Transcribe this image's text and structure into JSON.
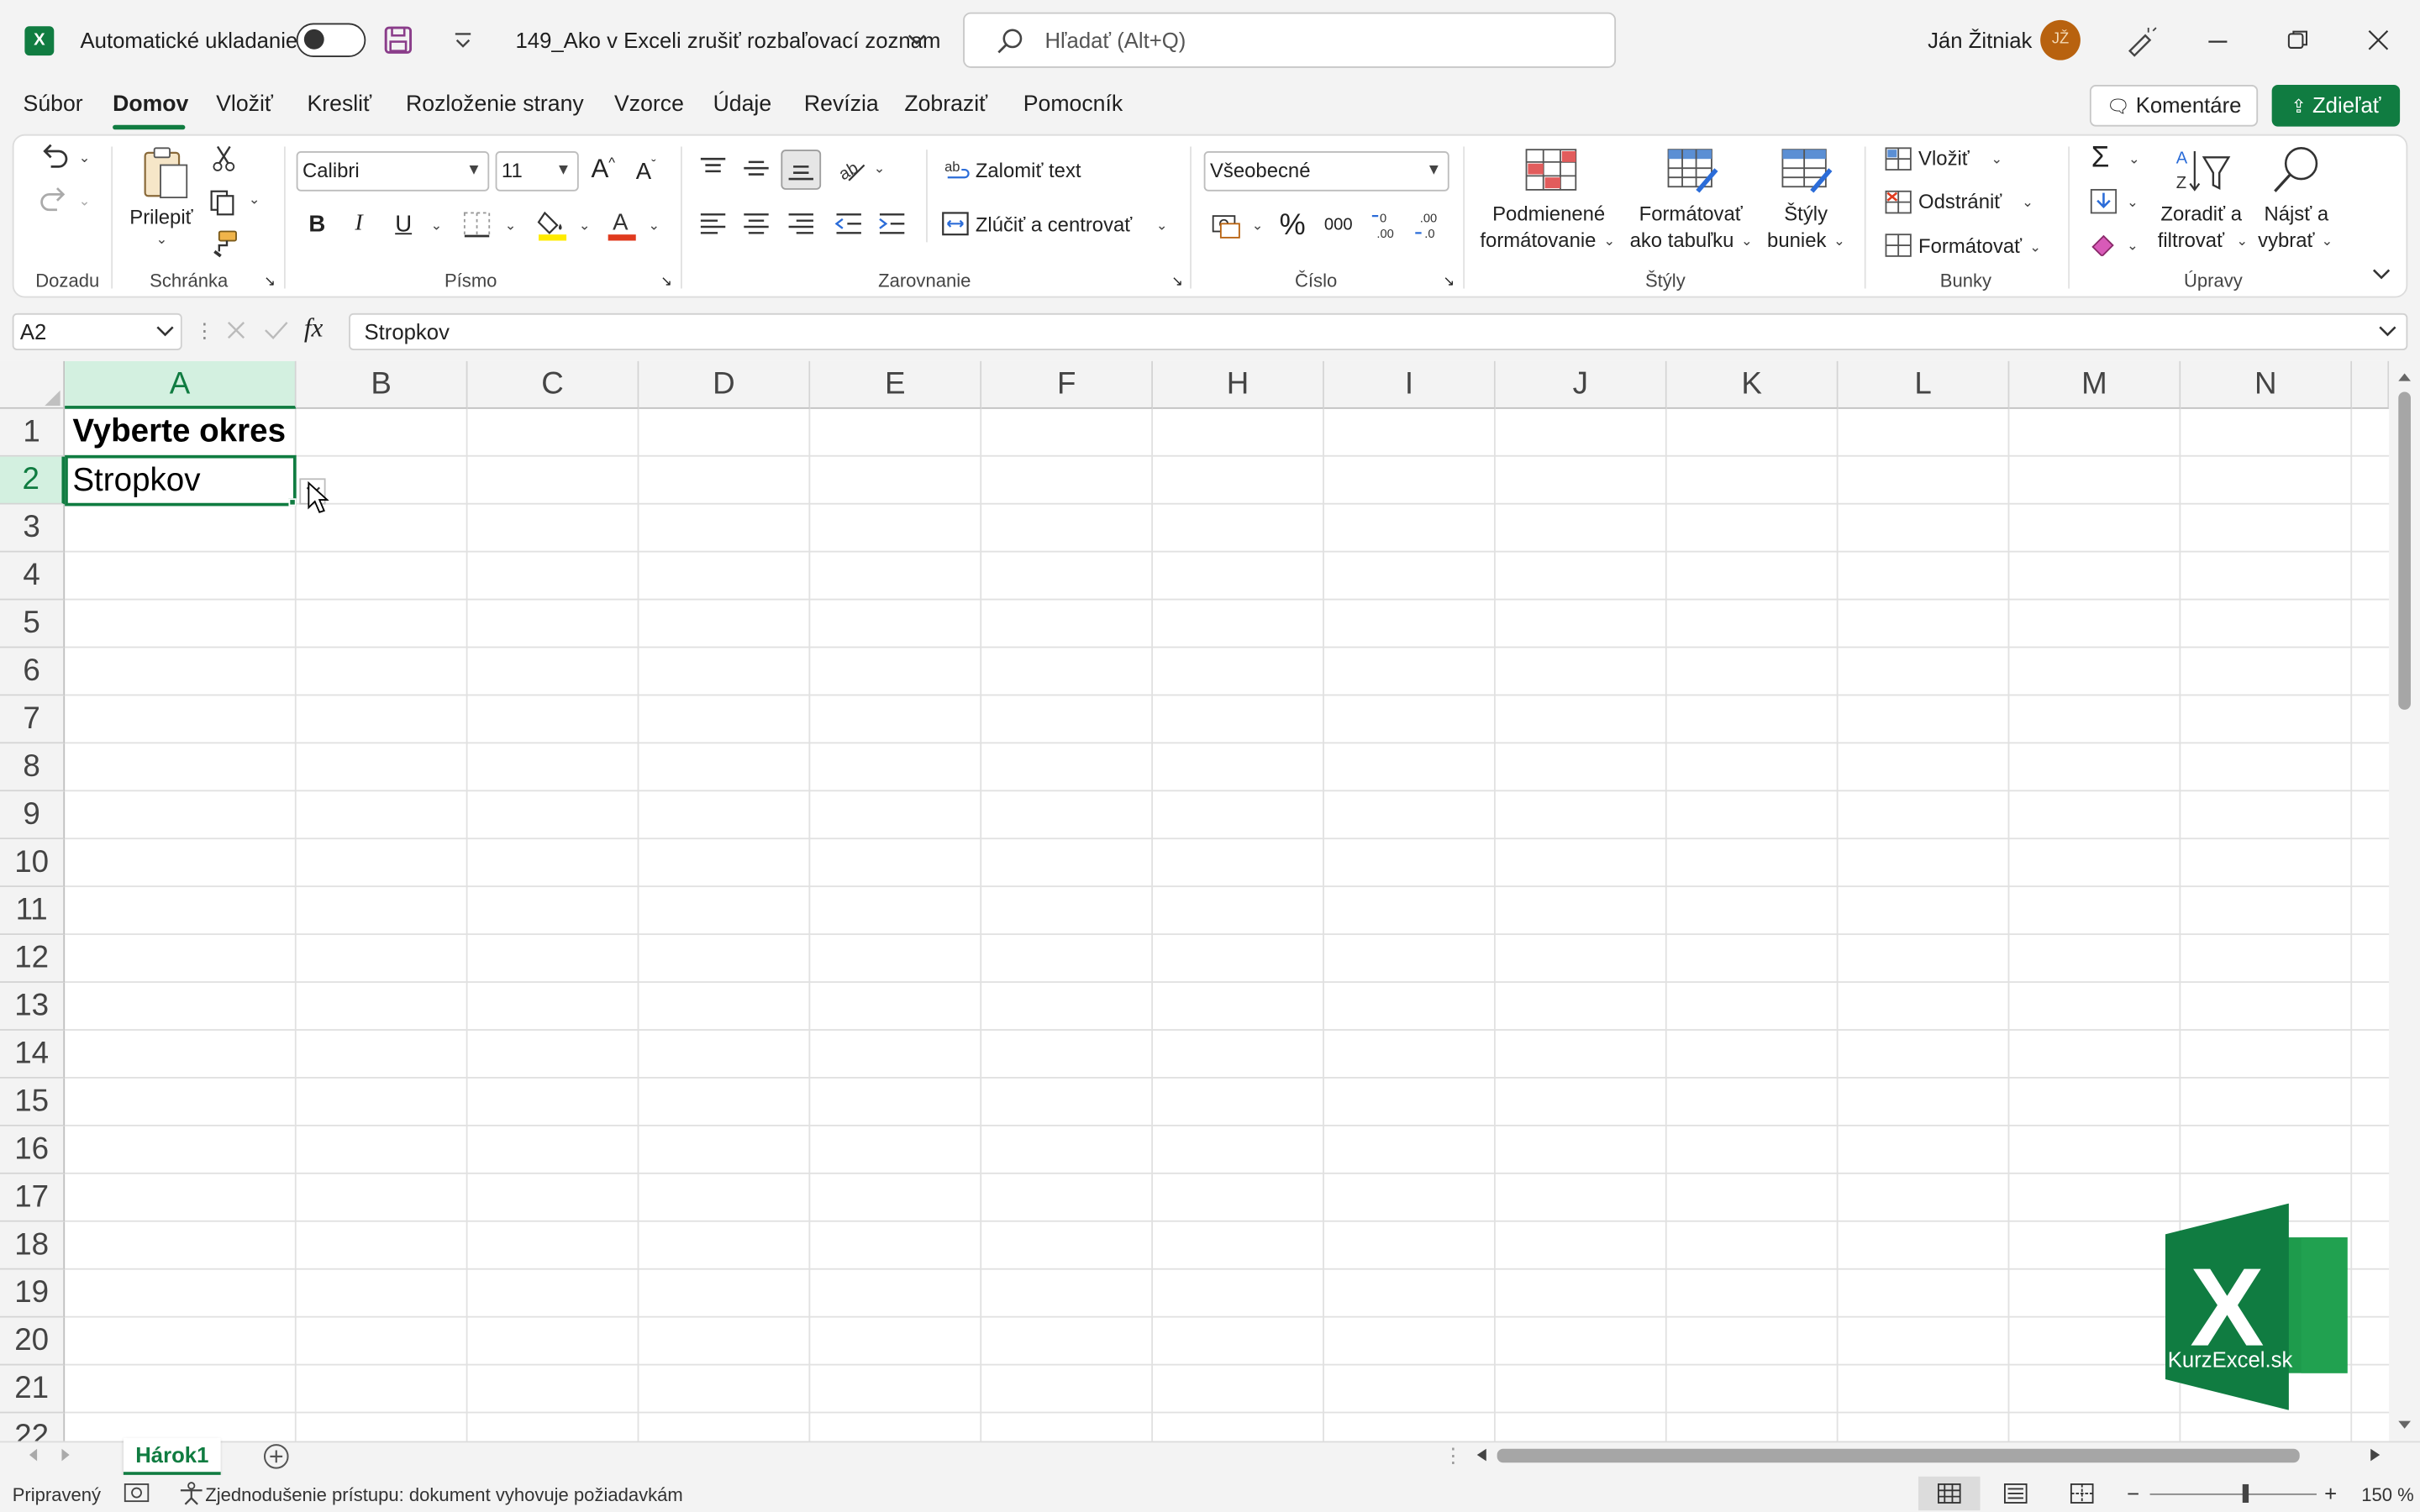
{
  "titlebar": {
    "app_icon": "excel-logo",
    "autosave_label": "Automatické ukladanie",
    "autosave_state": "off",
    "filename": "149_Ako v Exceli zrušiť rozbaľovací zoznam",
    "search_placeholder": "Hľadať (Alt+Q)",
    "user_name": "Ján Žitniak",
    "user_initials": "JŽ"
  },
  "tabs": [
    "Súbor",
    "Domov",
    "Vložiť",
    "Kresliť",
    "Rozloženie strany",
    "Vzorce",
    "Údaje",
    "Revízia",
    "Zobraziť",
    "Pomocník"
  ],
  "active_tab": "Domov",
  "header_buttons": {
    "comments": "Komentáre",
    "share": "Zdieľať"
  },
  "ribbon": {
    "groups": {
      "undo": "Dozadu",
      "clipboard": "Schránka",
      "font": "Písmo",
      "alignment": "Zarovnanie",
      "number": "Číslo",
      "styles": "Štýly",
      "cells": "Bunky",
      "editing": "Úpravy"
    },
    "paste_label": "Prilepiť",
    "font_name": "Calibri",
    "font_size": "11",
    "bold": "B",
    "italic": "I",
    "underline": "U",
    "wrap_text": "Zalomiť text",
    "merge_center": "Zlúčiť a centrovať",
    "number_format": "Všeobecné",
    "conditional_1": "Podmienené",
    "conditional_2": "formátovanie",
    "format_table_1": "Formátovať",
    "format_table_2": "ako tabuľku",
    "cell_styles_1": "Štýly",
    "cell_styles_2": "buniek",
    "insert": "Vložiť",
    "delete": "Odstrániť",
    "format": "Formátovať",
    "sort_1": "Zoradiť a",
    "sort_2": "filtrovať",
    "find_1": "Nájsť a",
    "find_2": "vybrať"
  },
  "formula_bar": {
    "name_box": "A2",
    "fx": "fx",
    "content": "Stropkov"
  },
  "columns": [
    "A",
    "B",
    "C",
    "D",
    "E",
    "F",
    "H",
    "I",
    "J",
    "K",
    "L",
    "M",
    "N"
  ],
  "rows": [
    "1",
    "2",
    "3",
    "4",
    "5",
    "6",
    "7",
    "8",
    "9",
    "10",
    "11",
    "12",
    "13",
    "14",
    "15",
    "16",
    "17",
    "18",
    "19",
    "20",
    "21",
    "22"
  ],
  "cells": {
    "A1": "Vyberte okres",
    "A2": "Stropkov"
  },
  "selected_cell": "A2",
  "sheet_tab": "Hárok1",
  "status": {
    "ready": "Pripravený",
    "accessibility": "Zjednodušenie prístupu: dokument vyhovuje požiadavkám",
    "zoom": "150 %"
  },
  "watermark": {
    "letter": "X",
    "text": "KurzExcel.sk"
  },
  "colors": {
    "accent": "#107c41",
    "header_sel": "#d3f0e0"
  }
}
